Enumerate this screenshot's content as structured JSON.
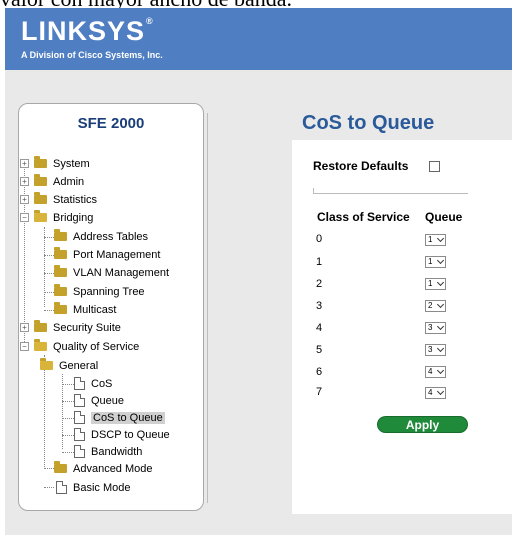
{
  "page_caption": "valor con mayor ancho de banda.",
  "brand": {
    "name": "LINKSYS",
    "registered": "®",
    "tagline": "A Division of Cisco Systems, Inc."
  },
  "device": "SFE 2000",
  "nav": {
    "system": "System",
    "admin": "Admin",
    "statistics": "Statistics",
    "bridging": "Bridging",
    "address_tables": "Address Tables",
    "port_management": "Port Management",
    "vlan_management": "VLAN Management",
    "spanning_tree": "Spanning Tree",
    "multicast": "Multicast",
    "security_suite": "Security Suite",
    "qos": "Quality of Service",
    "general": "General",
    "cos": "CoS",
    "queue": "Queue",
    "cos_to_queue": "CoS to Queue",
    "dscp_to_queue": "DSCP to Queue",
    "bandwidth": "Bandwidth",
    "advanced_mode": "Advanced Mode",
    "basic_mode": "Basic Mode"
  },
  "main": {
    "title": "CoS to Queue",
    "restore_defaults": "Restore Defaults",
    "col_cos": "Class of Service",
    "col_queue": "Queue",
    "rows": [
      {
        "cos": "0",
        "queue": "1"
      },
      {
        "cos": "1",
        "queue": "1"
      },
      {
        "cos": "2",
        "queue": "1"
      },
      {
        "cos": "3",
        "queue": "2"
      },
      {
        "cos": "4",
        "queue": "3"
      },
      {
        "cos": "5",
        "queue": "3"
      },
      {
        "cos": "6",
        "queue": "4"
      },
      {
        "cos": "7",
        "queue": "4"
      }
    ],
    "apply": "Apply"
  }
}
